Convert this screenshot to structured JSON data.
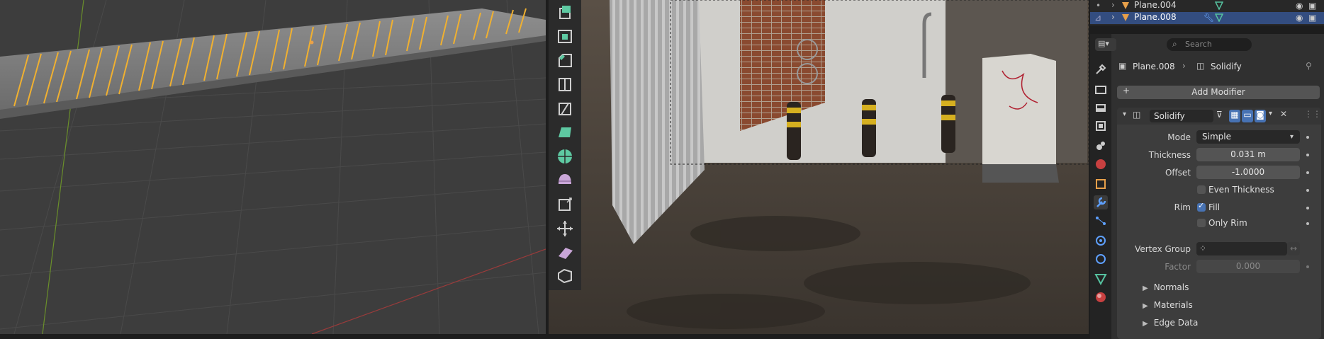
{
  "outliner": {
    "rows": [
      {
        "name": "Plane.004",
        "selected": false
      },
      {
        "name": "Plane.008",
        "selected": true
      }
    ]
  },
  "properties": {
    "search_placeholder": "Search",
    "breadcrumb_object": "Plane.008",
    "breadcrumb_modifier": "Solidify",
    "add_modifier_label": "Add Modifier",
    "modifier_name": "Solidify",
    "fields": {
      "mode_label": "Mode",
      "mode_value": "Simple",
      "thickness_label": "Thickness",
      "thickness_value": "0.031 m",
      "offset_label": "Offset",
      "offset_value": "-1.0000",
      "even_thickness_label": "Even Thickness",
      "even_thickness_checked": false,
      "rim_label": "Rim",
      "fill_label": "Fill",
      "fill_checked": true,
      "only_rim_label": "Only Rim",
      "only_rim_checked": false,
      "vertex_group_label": "Vertex Group",
      "vertex_group_value": "",
      "factor_label": "Factor",
      "factor_value": "0.000"
    },
    "subpanels": [
      "Normals",
      "Materials",
      "Edge Data"
    ]
  },
  "colors": {
    "accent_selected": "#334d80",
    "checkbox_on": "#4772b3",
    "object_orange": "#e8a04a",
    "mesh_green": "#56c2a0"
  },
  "icons": {
    "left_toolbar": [
      "extrude-region-icon",
      "inset-faces-icon",
      "bevel-icon",
      "loop-cut-icon",
      "knife-icon",
      "poly-build-icon",
      "spin-icon",
      "smooth-icon",
      "shrink-fatten-icon",
      "push-pull-icon",
      "shear-icon",
      "rip-region-icon"
    ],
    "property_tabs": [
      "tool-icon",
      "render-icon",
      "output-icon",
      "view-layer-icon",
      "scene-icon",
      "world-icon",
      "object-icon",
      "modifier-wrench-icon",
      "particles-icon",
      "physics-icon",
      "constraints-icon",
      "data-icon",
      "material-icon"
    ]
  }
}
